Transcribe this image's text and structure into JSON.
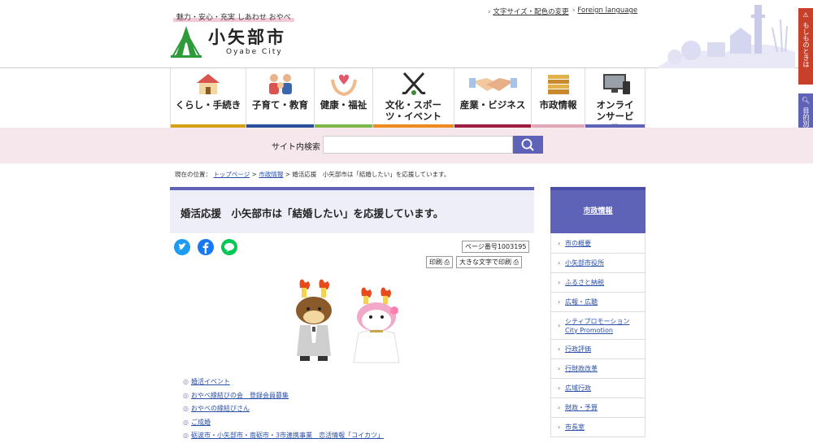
{
  "header": {
    "tagline": "魅力・安心・充実 しあわせ おやべ",
    "logo_jp": "小矢部市",
    "logo_en": "Oyabe City",
    "util_links": [
      "文字サイズ・配色の変更",
      "Foreign language"
    ]
  },
  "side_buttons": {
    "emergency": "もしものときは",
    "purpose_search": "目的別検索"
  },
  "nav": {
    "items": [
      {
        "label": "くらし・手続き",
        "icon": "house-icon",
        "color": "#d4a018"
      },
      {
        "label": "子育て・教育",
        "icon": "family-icon",
        "color": "#2a4f9a"
      },
      {
        "label": "健康・福祉",
        "icon": "heart-hands-icon",
        "color": "#7fb84a"
      },
      {
        "label": "文化・スポーツ・イベント",
        "icon": "hockey-sticks-icon",
        "color": "#ef8a1e"
      },
      {
        "label": "産業・ビジネス",
        "icon": "handshake-icon",
        "color": "#9e1c3c"
      },
      {
        "label": "市政情報",
        "icon": "documents-icon",
        "color": "#e0a8b8"
      },
      {
        "label": "オンラインサービス",
        "icon": "computer-icon",
        "color": "#5f63b8"
      }
    ]
  },
  "search": {
    "label": "サイト内検索",
    "value": "",
    "placeholder": ""
  },
  "breadcrumb": {
    "prefix": "現在の位置：",
    "items": [
      "トップページ",
      "市政情報"
    ],
    "current": "婚活応援　小矢部市は「結婚したい」を応援しています。",
    "separator": ">"
  },
  "page": {
    "title": "婚活応援　小矢部市は「結婚したい」を応援しています。",
    "page_number": "ページ番号1003195",
    "print_label": "印刷",
    "print_large_label": "大きな文字で印刷"
  },
  "links": [
    "婚活イベント",
    "おやべ縁結びの会　登録会員募集",
    "おやべの縁結びさん",
    "ご成婚",
    "砺波市・小矢部市・南砺市・3市連携事業　恋活情報「コイカツ」"
  ],
  "sidebar": {
    "heading": "市政情報",
    "items": [
      "市の概要",
      "小矢部市役所",
      "ふるさと納税",
      "広報・広聴",
      "シティプロモーション\nCity Promotion",
      "行政評価",
      "行財政改革",
      "広域行政",
      "財政・予算",
      "市長室"
    ]
  },
  "colors": {
    "accent": "#5f63b8",
    "search_band": "#f6e7ec",
    "link": "#2a4fa8",
    "emergency": "#c8402a"
  }
}
